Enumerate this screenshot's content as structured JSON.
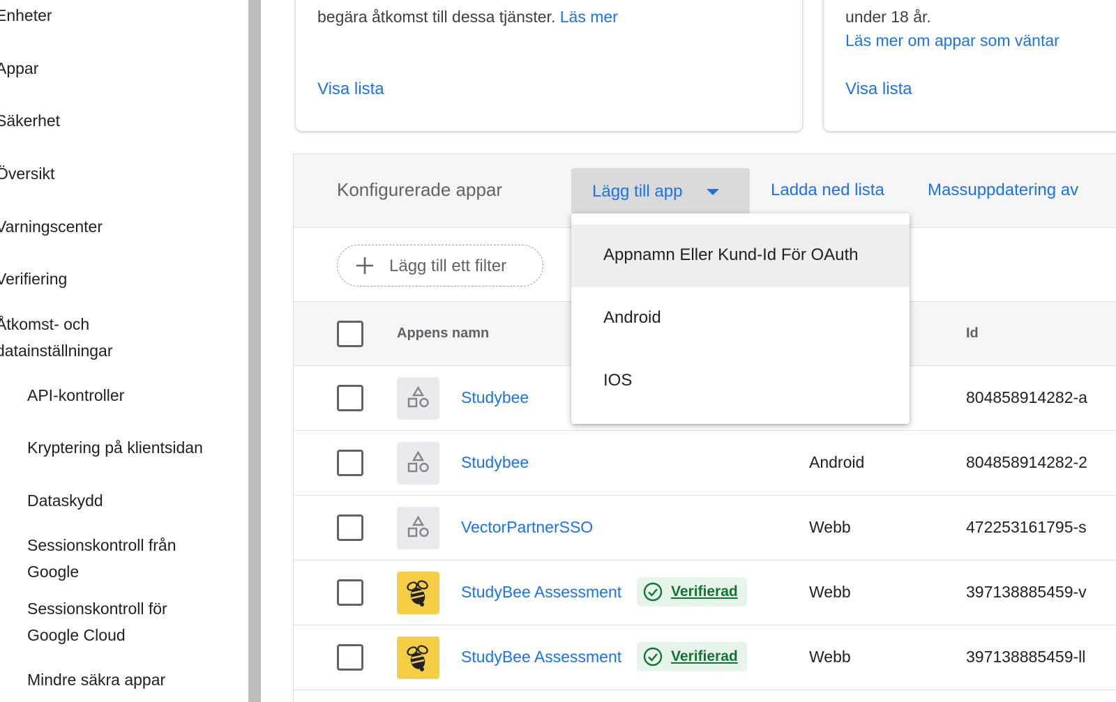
{
  "sidebar": {
    "items": [
      {
        "label": "Enheter"
      },
      {
        "label": "Appar"
      },
      {
        "label": "Säkerhet"
      },
      {
        "label": "Översikt"
      },
      {
        "label": "Varningscenter"
      },
      {
        "label": "Verifiering"
      },
      {
        "label_line1": "Åtkomst- och",
        "label_line2": "datainställningar"
      },
      {
        "label": "API-kontroller"
      },
      {
        "label": "Kryptering på klientsidan"
      },
      {
        "label": "Dataskydd"
      },
      {
        "label_line1": "Sessionskontroll från",
        "label_line2": "Google"
      },
      {
        "label_line1": "Sessionskontroll för",
        "label_line2": "Google Cloud"
      },
      {
        "label": "Mindre säkra appar"
      }
    ]
  },
  "cards": [
    {
      "text": "begära åtkomst till dessa tjänster.",
      "link": "Läs mer",
      "list_link": "Visa lista"
    },
    {
      "text": "under 18 år.",
      "link": "Läs mer om appar som väntar",
      "list_link": "Visa lista"
    }
  ],
  "panel": {
    "title": "Konfigurerade appar",
    "add_app_label": "Lägg till app",
    "download_label": "Ladda ned lista",
    "bulk_label": "Massuppdatering av",
    "filter_label": "Lägg till ett filter",
    "columns": {
      "name": "Appens namn",
      "id": "Id"
    }
  },
  "menu": {
    "items": [
      "Appnamn Eller Kund-Id För OAuth",
      "Android",
      "IOS"
    ]
  },
  "rows": [
    {
      "name": "Studybee",
      "icon": "generic-app-icon",
      "type": "",
      "id": "804858914282-a",
      "verified": ""
    },
    {
      "name": "Studybee",
      "icon": "generic-app-icon",
      "type": "Android",
      "id": "804858914282-2",
      "verified": ""
    },
    {
      "name": "VectorPartnerSSO",
      "icon": "generic-app-icon",
      "type": "Webb",
      "id": "472253161795-s",
      "verified": ""
    },
    {
      "name": "StudyBee Assessment",
      "icon": "bee-icon",
      "type": "Webb",
      "id": "397138885459-v",
      "verified": "Verifierad"
    },
    {
      "name": "StudyBee Assessment",
      "icon": "bee-icon",
      "type": "Webb",
      "id": "397138885459-ll",
      "verified": "Verifierad"
    }
  ],
  "colors": {
    "link": "#1a73e8",
    "verified_bg": "#e6f4ea",
    "verified_text": "#137333",
    "bee_bg": "#f6ce45"
  }
}
